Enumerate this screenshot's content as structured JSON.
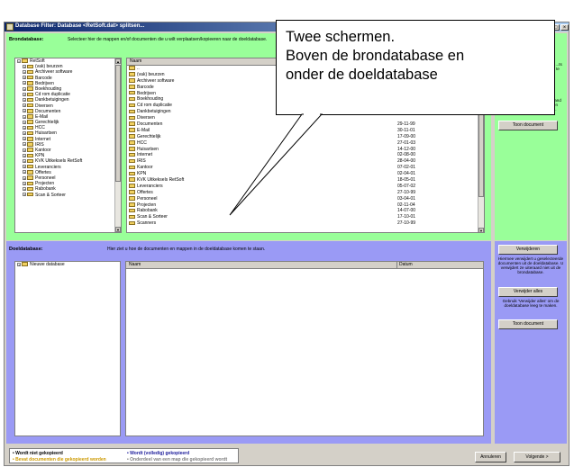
{
  "window": {
    "title": "Database Filter: Database <RetSoft.dat> splitsen...",
    "controls": [
      "_",
      "□",
      "×"
    ]
  },
  "source": {
    "label": "Brondatabase:",
    "instruction": "Selecteer hier de mappen en/of documenten die u wilt verplaatsen/kopieeren naar de doeldatabase.",
    "tree_root": "RetSoft",
    "tree_items": [
      "(vak) beurzen",
      "Archiveer software",
      "Barcode",
      "Bedrijven",
      "Boekhouding",
      "Cd rom duplicatie",
      "Dankbetuigingen",
      "Diversen",
      "Documenten",
      "E-Mail",
      "Gerechtelijk",
      "HCC",
      "Huisartsen",
      "Internet",
      "IRIS",
      "Kantoor",
      "KPN",
      "KVK Uitkeksels RetSoft",
      "Leveranciers",
      "Offertes",
      "Personeel",
      "Projecten",
      "Rabobank",
      "Scan & Sorteer"
    ],
    "list_headers": {
      "name": "Naam",
      "date": ""
    },
    "list_rows": [
      {
        "name": "..",
        "date": ""
      },
      {
        "name": "(vak) beurzen",
        "date": ""
      },
      {
        "name": "Archiveer software",
        "date": ""
      },
      {
        "name": "Barcode",
        "date": ""
      },
      {
        "name": "Bedrijven",
        "date": ""
      },
      {
        "name": "Boekhouding",
        "date": ""
      },
      {
        "name": "Cd rom duplicatie",
        "date": ""
      },
      {
        "name": "Dankbetuigingen",
        "date": ""
      },
      {
        "name": "Diversen",
        "date": ""
      },
      {
        "name": "Documenten",
        "date": "29-11-99"
      },
      {
        "name": "E-Mail",
        "date": "30-11-01"
      },
      {
        "name": "Gerechtelijk",
        "date": "17-09-00"
      },
      {
        "name": "HCC",
        "date": "27-01-03"
      },
      {
        "name": "Huisartsen",
        "date": "14-12-00"
      },
      {
        "name": "Internet",
        "date": "02-08-00"
      },
      {
        "name": "IRIS",
        "date": "28-04-00"
      },
      {
        "name": "Kantoor",
        "date": "07-02-01"
      },
      {
        "name": "KPN",
        "date": "02-04-01"
      },
      {
        "name": "KVK Uitkeksels RetSoft",
        "date": "18-05-01"
      },
      {
        "name": "Leveranciers",
        "date": "05-07-02"
      },
      {
        "name": "Offertes",
        "date": "27-10-99"
      },
      {
        "name": "Personeel",
        "date": "03-04-01"
      },
      {
        "name": "Projecten",
        "date": "02-11-04"
      },
      {
        "name": "Rabobank",
        "date": "14-07-00"
      },
      {
        "name": "Scan & Sorteer",
        "date": "17-10-01"
      },
      {
        "name": "Scanners",
        "date": "27-10-99"
      }
    ],
    "side": {
      "desc1": "...uit enkel database ...voegen. ...ts en ...teren te",
      "desc2": "...e hand ...f een ...cen.",
      "show_doc": "Toon document"
    }
  },
  "target": {
    "label": "Doeldatabase:",
    "instruction": "Hier ziet u hoe de documenten en mappen in de doeldatabase komen te staan.",
    "tree_root": "Nieuwe database",
    "list_headers": {
      "name": "Naam",
      "date": "Datum"
    },
    "side": {
      "remove": "Verwijderen",
      "remove_desc": "Hiermee verwijdert u geselecteerde documenten uit de doeldatabase. U verwijdert ze uiteraard niet uit de brondatabase.",
      "remove_all": "Verwijder alles",
      "remove_all_desc": "Gebruik 'Verwijder alles' om de doeldatabase leeg te maken.",
      "show_doc": "Toon document"
    }
  },
  "legend": {
    "not_copied": "• Wordt niet gekopieerd",
    "fully_copied": "• Wordt (volledig) gekopieerd",
    "contains_copied": "• Bevat documenten die gekopieerd worden",
    "part_of_copied": "• Onderdeel van een map die gekopieerd wordt",
    "colors": {
      "not_copied": "#000000",
      "fully_copied": "#1a1a9a",
      "contains_copied": "#cc9900",
      "part_of_copied": "#808080"
    }
  },
  "footer": {
    "cancel": "Annuleren",
    "next": "Volgende >"
  },
  "callout": {
    "lines": [
      "Twee schermen.",
      "Boven de brondatabase en",
      "onder de doeldatabase"
    ]
  }
}
